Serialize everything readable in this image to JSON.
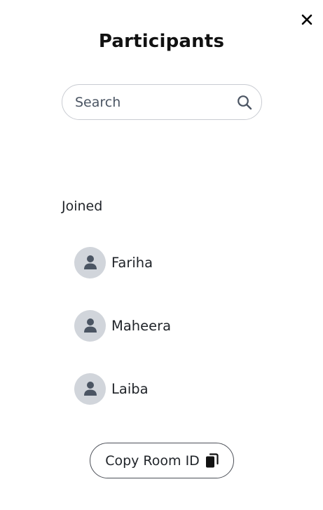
{
  "dialog": {
    "title": "Participants",
    "close_icon": "close-icon"
  },
  "search": {
    "placeholder": "Search",
    "value": "",
    "icon": "search-icon"
  },
  "joined": {
    "label": "Joined",
    "participants": [
      {
        "name": "Fariha",
        "avatar_icon": "user-icon"
      },
      {
        "name": "Maheera",
        "avatar_icon": "user-icon"
      },
      {
        "name": "Laiba",
        "avatar_icon": "user-icon"
      }
    ]
  },
  "copy_room": {
    "label": "Copy Room ID",
    "icon": "copy-icon"
  },
  "colors": {
    "avatar_bg": "#d1d5db",
    "avatar_icon": "#4b5563",
    "text": "#1f2328",
    "border": "#c9ccd2"
  }
}
